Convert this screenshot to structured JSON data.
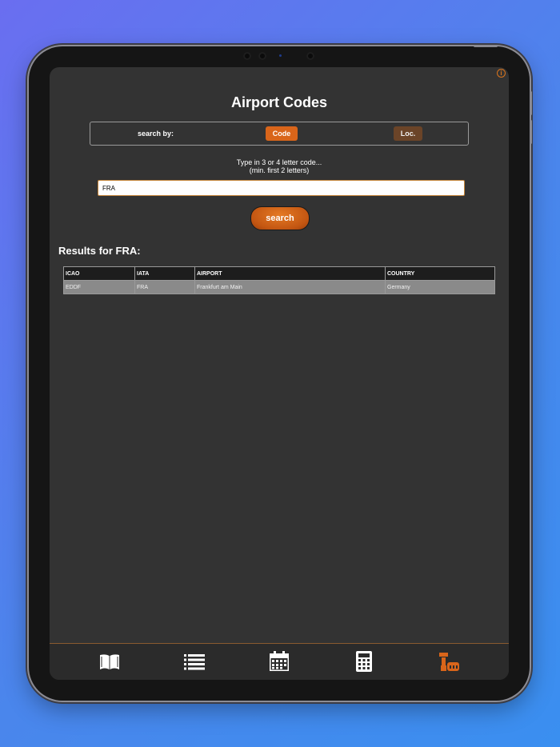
{
  "header": {
    "title": "Airport Codes"
  },
  "search_by": {
    "label": "search by:",
    "code_button": "Code",
    "loc_button": "Loc."
  },
  "hint": {
    "line1": "Type in 3 or 4 letter code...",
    "line2": "(min. first 2 letters)"
  },
  "input": {
    "value": "FRA"
  },
  "search_button": "search",
  "results": {
    "heading": "Results for FRA:",
    "columns": [
      "ICAO",
      "IATA",
      "AIRPORT",
      "COUNTRY"
    ],
    "rows": [
      {
        "icao": "EDDF",
        "iata": "FRA",
        "airport": "Frankfurt am Main",
        "country": "Germany"
      }
    ]
  },
  "tabbar": {
    "tabs": [
      {
        "icon": "book-icon",
        "active": false
      },
      {
        "icon": "list-icon",
        "active": false
      },
      {
        "icon": "calendar-icon",
        "active": false
      },
      {
        "icon": "calculator-icon",
        "active": false
      },
      {
        "icon": "control-tower-icon",
        "active": true
      }
    ]
  },
  "colors": {
    "accent": "#d9651a",
    "background": "#333333",
    "active_tab": "#d9651a",
    "inactive_tab": "#ffffff"
  }
}
